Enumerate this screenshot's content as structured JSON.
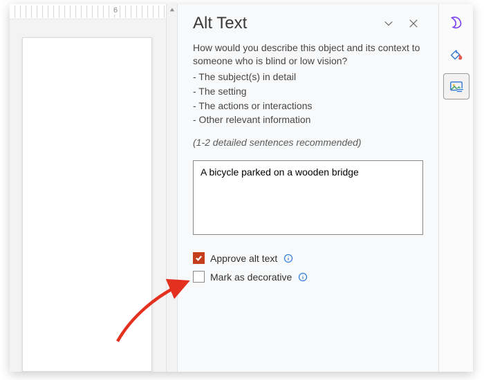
{
  "ruler": {
    "mark6": "6"
  },
  "panel": {
    "title": "Alt Text",
    "description": "How would you describe this object and its context to someone who is blind or low vision?",
    "bullets": [
      "- The subject(s) in detail",
      "- The setting",
      "- The actions or interactions",
      "- Other relevant information"
    ],
    "hint": "(1-2 detailed sentences recommended)",
    "alt_value": "A bicycle parked on a wooden bridge",
    "approve_label": "Approve alt text",
    "approve_checked": true,
    "decorative_label": "Mark as decorative",
    "decorative_checked": false
  },
  "rail": {
    "designer": "designer",
    "styles": "styles",
    "alt_text": "alt-text"
  },
  "colors": {
    "accent_check": "#c43e1c",
    "info": "#1f74db",
    "designer_purple": "#7b3ff2"
  }
}
